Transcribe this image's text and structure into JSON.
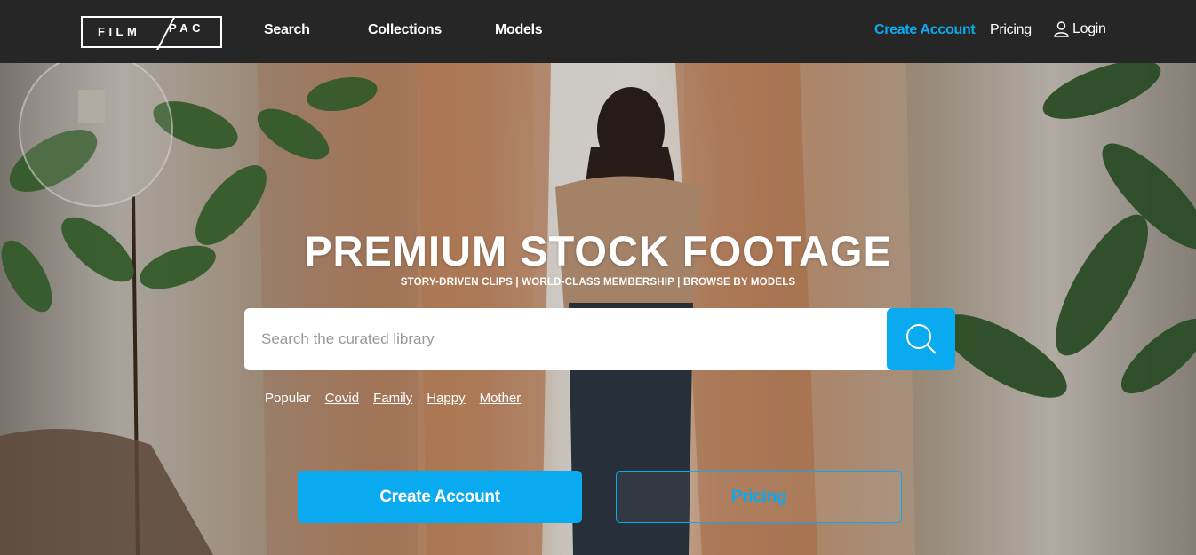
{
  "brand": {
    "logo_left": "FILM",
    "logo_right": "PAC"
  },
  "nav": {
    "search": "Search",
    "collections": "Collections",
    "models": "Models",
    "create_account": "Create Account",
    "pricing": "Pricing",
    "login": "Login"
  },
  "hero": {
    "title": "PREMIUM STOCK FOOTAGE",
    "subtitle": "STORY-DRIVEN CLIPS | WORLD-CLASS MEMBERSHIP | BROWSE BY MODELS",
    "search_placeholder": "Search the curated library",
    "popular_label": "Popular",
    "tags": [
      "Covid",
      "Family",
      "Happy",
      "Mother"
    ],
    "cta_primary": "Create Account",
    "cta_secondary": "Pricing"
  },
  "colors": {
    "accent": "#0aaaf0",
    "nav_bg": "#262626"
  }
}
